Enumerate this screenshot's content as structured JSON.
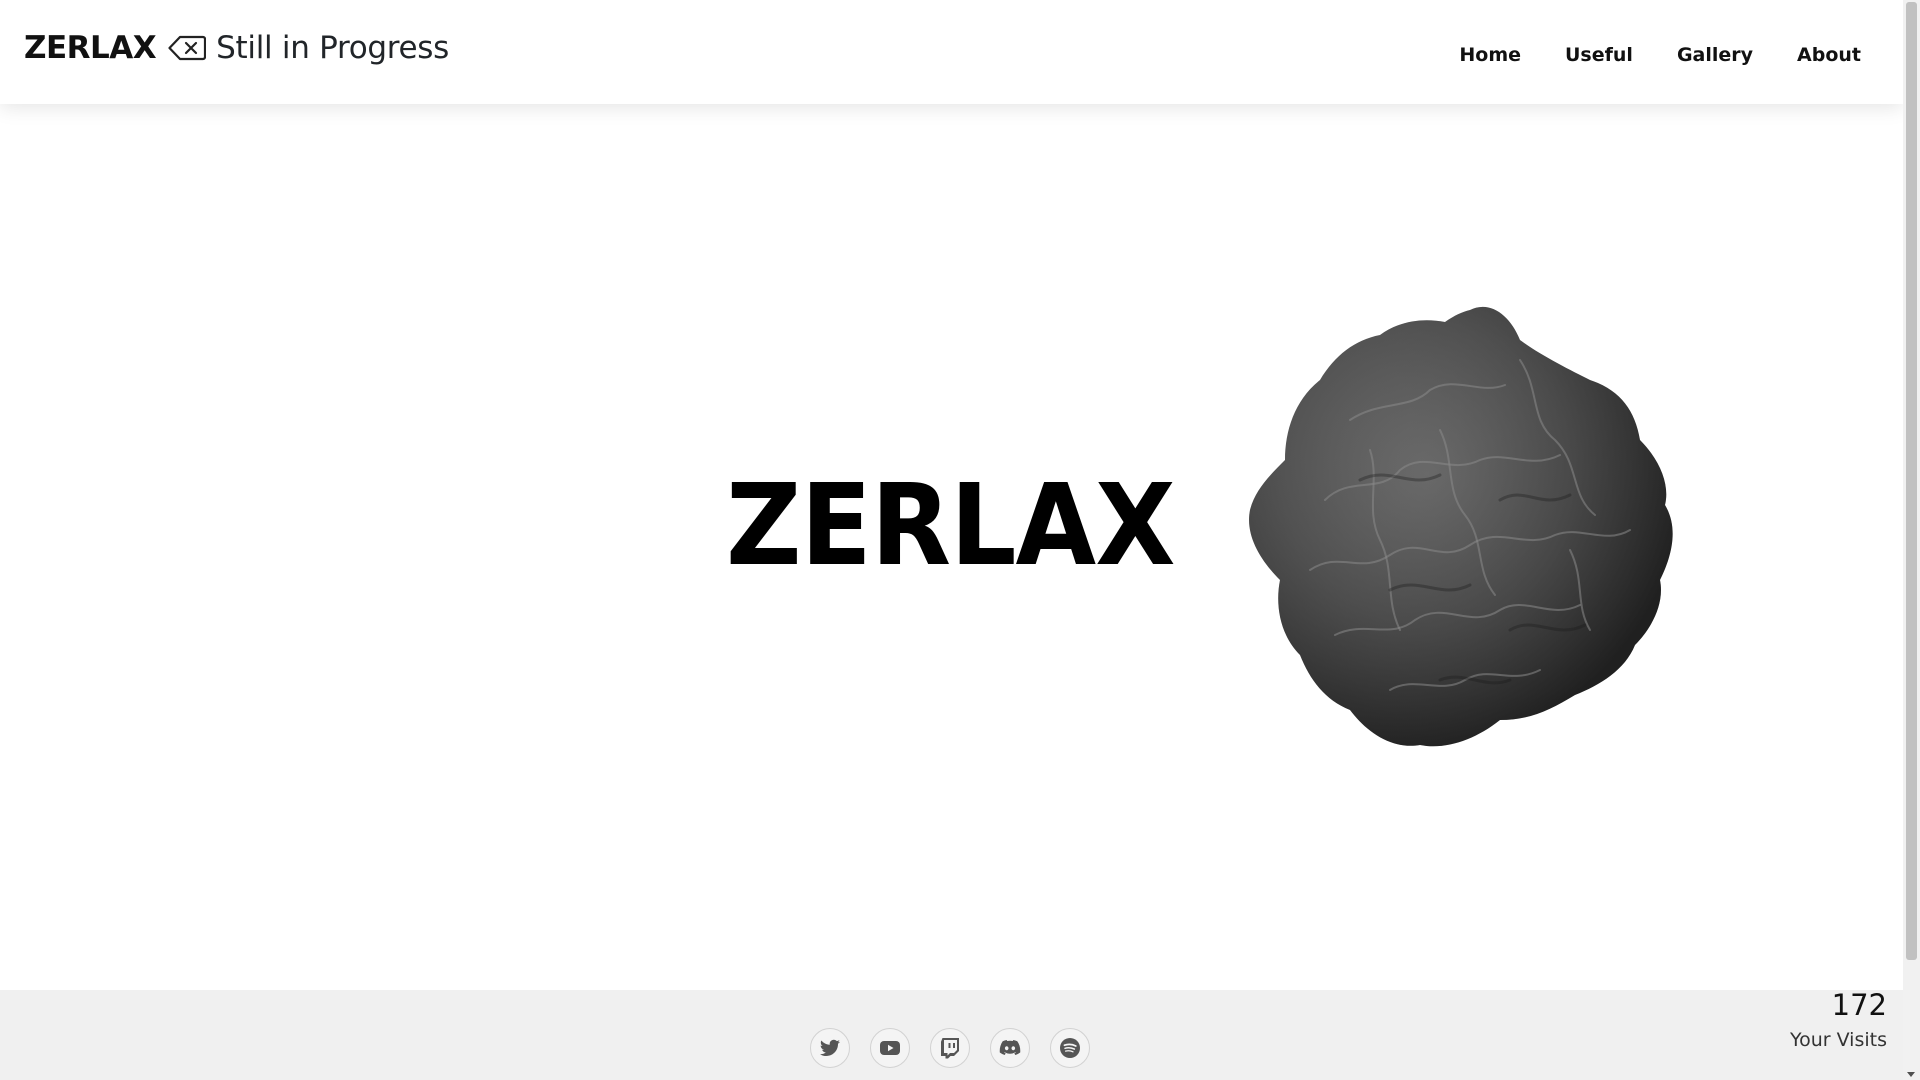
{
  "header": {
    "brand_name": "ZERLAX",
    "brand_icon": "backspace-icon",
    "brand_subtitle": "Still in Progress",
    "nav": [
      {
        "label": "Home"
      },
      {
        "label": "Useful"
      },
      {
        "label": "Gallery"
      },
      {
        "label": "About"
      }
    ]
  },
  "hero": {
    "title": "ZERLAX",
    "visual": "3d-blob-sphere"
  },
  "footer": {
    "socials": [
      {
        "name": "twitter-icon"
      },
      {
        "name": "youtube-icon"
      },
      {
        "name": "twitch-icon"
      },
      {
        "name": "discord-icon"
      },
      {
        "name": "spotify-icon"
      }
    ],
    "visits_count": "172",
    "visits_label": "Your Visits"
  },
  "colors": {
    "text": "#111111",
    "footer_bg": "#f0f0f0",
    "icon": "#555555"
  }
}
